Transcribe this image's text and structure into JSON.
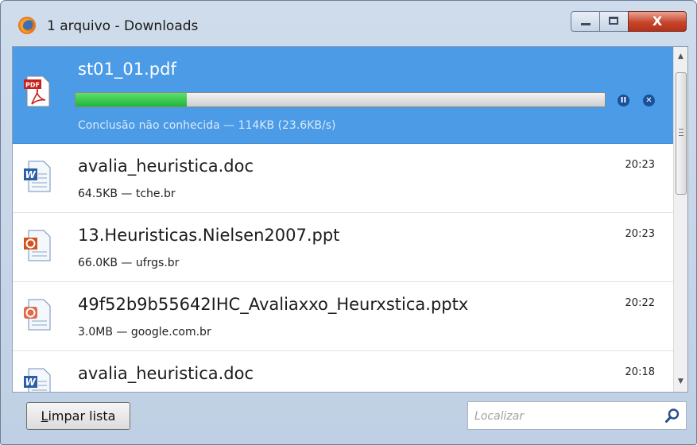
{
  "window": {
    "title": "1 arquivo - Downloads",
    "close_label": "X"
  },
  "active_download": {
    "file_name": "st01_01.pdf",
    "icon": "pdf-icon",
    "status": "Conclusão não conhecida — 114KB (23.6KB/s)",
    "progress_fraction": 0.21,
    "pause_glyph": "II",
    "cancel_glyph": "✕"
  },
  "downloads": [
    {
      "file_name": "avalia_heuristica.doc",
      "meta": "64.5KB — tche.br",
      "time": "20:23",
      "icon": "word-doc-icon"
    },
    {
      "file_name": "13.Heuristicas.Nielsen2007.ppt",
      "meta": "66.0KB — ufrgs.br",
      "time": "20:23",
      "icon": "powerpoint-icon"
    },
    {
      "file_name": "49f52b9b55642IHC_Avaliaxxo_Heurxstica.pptx",
      "meta": "3.0MB — google.com.br",
      "time": "20:22",
      "icon": "powerpoint-icon"
    },
    {
      "file_name": "avalia_heuristica.doc",
      "meta": "",
      "time": "20:18",
      "icon": "word-doc-icon"
    }
  ],
  "footer": {
    "clear_button_first": "L",
    "clear_button_rest": "impar lista",
    "search_placeholder": "Localizar"
  },
  "colors": {
    "selected_row": "#4b9be6",
    "progress_fill": "#1fb43a",
    "close_button": "#c6452b"
  }
}
